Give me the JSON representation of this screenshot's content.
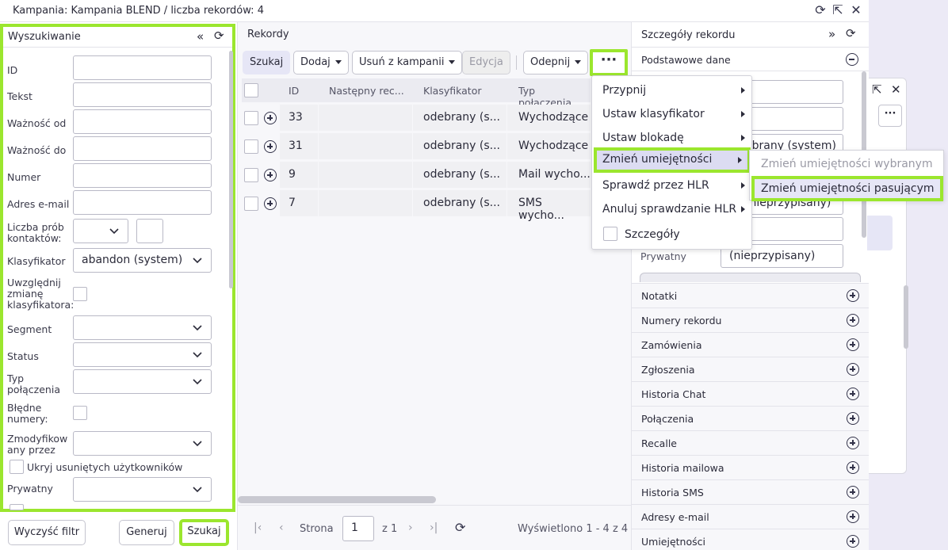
{
  "window": {
    "title": "Kampania: Kampania BLEND / liczba rekordów: 4"
  },
  "search": {
    "title": "Wyszukiwanie",
    "fields": {
      "id": "ID",
      "tekst": "Tekst",
      "waznosc_od": "Ważność od",
      "waznosc_do": "Ważność do",
      "numer": "Numer",
      "adres": "Adres e-mail",
      "liczba_prob_1": "Liczba prób",
      "liczba_prob_2": "kontaktów:",
      "klasyfikator": "Klasyfikator",
      "klasyfikator_value": "abandon (system)",
      "uwzgl_1": "Uwzględnij",
      "uwzgl_2": "zmianę",
      "uwzgl_3": "klasyfikatora:",
      "segment": "Segment",
      "status": "Status",
      "typ_1": "Typ",
      "typ_2": "połączenia",
      "bledne_1": "Błędne",
      "bledne_2": "numery:",
      "zmod_1": "Zmodyfikow",
      "zmod_2": "any przez",
      "ukryj": "Ukryj usuniętych użytkowników",
      "prywatny": "Prywatny"
    },
    "buttons": {
      "clear": "Wyczyść filtr",
      "generate": "Generuj",
      "search": "Szukaj"
    }
  },
  "records": {
    "title": "Rekordy",
    "toolbar": {
      "search": "Szukaj",
      "add": "Dodaj",
      "remove": "Usuń z kampanii",
      "edit": "Edycja",
      "unpin": "Odepnij",
      "more": "···"
    },
    "columns": [
      "ID",
      "Następny rec...",
      "Klasyfikator",
      "Typ połączenia"
    ],
    "rows": [
      {
        "id": "33",
        "klas": "odebrany (s...",
        "typ": "Wychodzące"
      },
      {
        "id": "31",
        "klas": "odebrany (s...",
        "typ": "Wychodzące"
      },
      {
        "id": "9",
        "klas": "odebrany (s...",
        "typ": "Mail wycho..."
      },
      {
        "id": "7",
        "klas": "odebrany (s...",
        "typ": "SMS wycho..."
      }
    ],
    "footer": {
      "page_label": "Strona",
      "page_value": "1",
      "of": "z 1",
      "shown": "Wyświetlono 1 - 4 z 4"
    }
  },
  "menu": {
    "items": [
      "Przypnij",
      "Ustaw klasyfikator",
      "Ustaw blokadę",
      "Zmień umiejętności",
      "Sprawdź przez HLR",
      "Anuluj sprawdzanie HLR",
      "Szczegóły"
    ],
    "submenu": [
      "Zmień umiejętności wybranym",
      "Zmień umiejętności pasującym"
    ]
  },
  "details": {
    "title": "Szczegóły rekordu",
    "basic": "Podstawowe dane",
    "partial_1": "ebrany (system)",
    "partial_2": "(nieprzypisany)",
    "prywatny_label": "Prywatny",
    "prywatny_value": "(nieprzypisany)",
    "sections": [
      "Notatki",
      "Numery rekordu",
      "Zamówienia",
      "Zgłoszenia",
      "Historia Chat",
      "Połączenia",
      "Recalle",
      "Historia mailowa",
      "Historia SMS",
      "Adresy e-mail",
      "Umiejętności"
    ]
  },
  "colors": {
    "highlight": "#9be62e",
    "tint": "#e6e6f6"
  }
}
